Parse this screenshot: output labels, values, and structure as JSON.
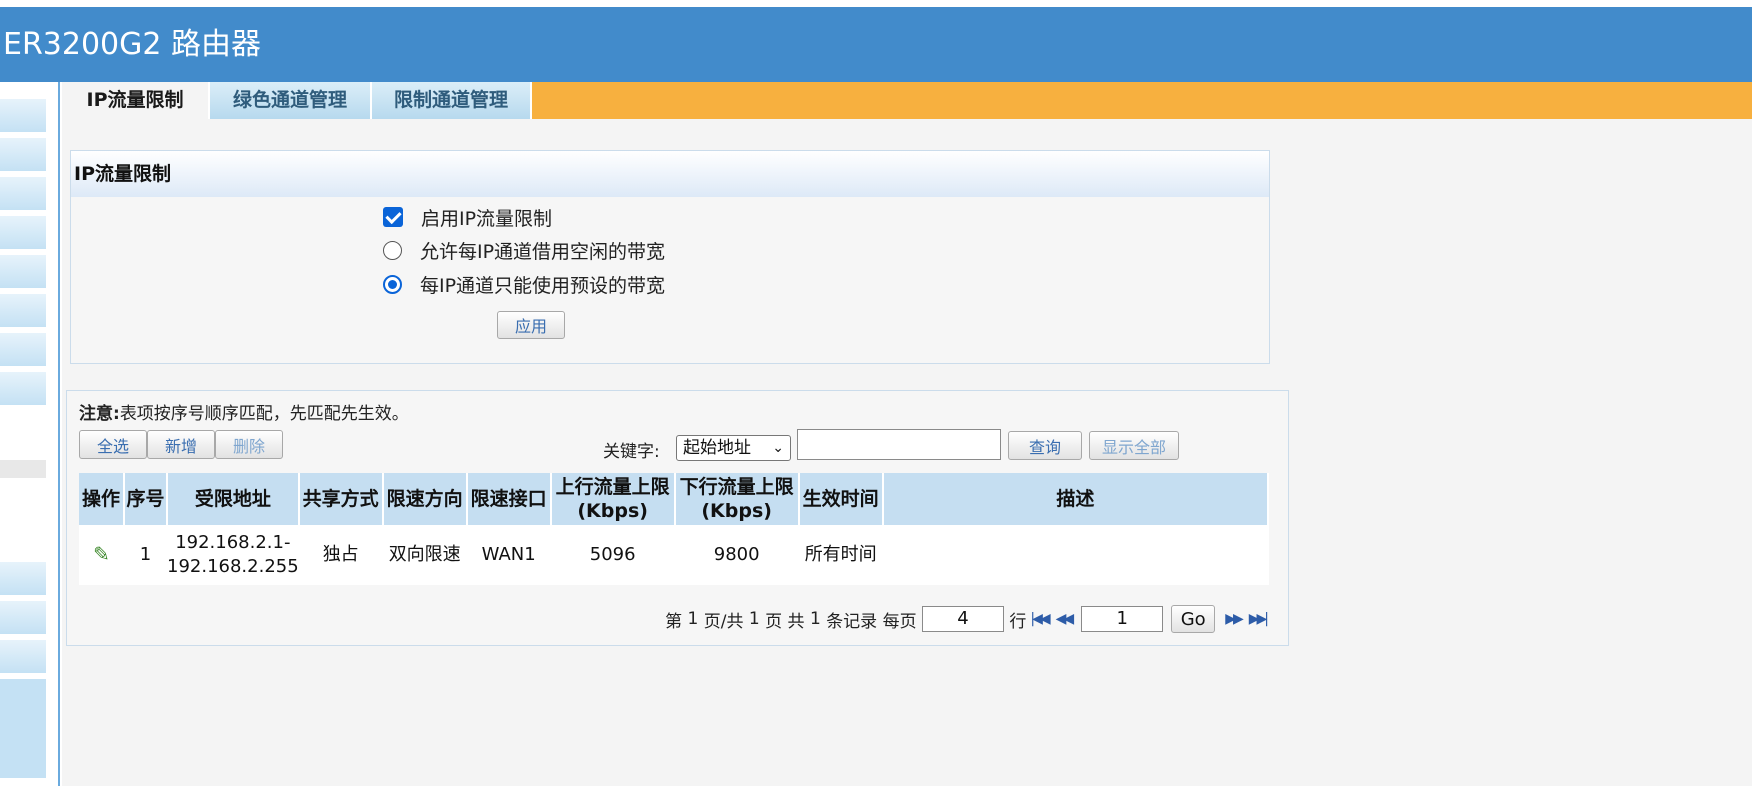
{
  "header": {
    "title": "ER3200G2 路由器"
  },
  "tabs": [
    {
      "label": "IP流量限制",
      "active": true
    },
    {
      "label": "绿色通道管理",
      "active": false
    },
    {
      "label": "限制通道管理",
      "active": false
    }
  ],
  "ip_limit_panel": {
    "title": "IP流量限制",
    "enable_label": "启用IP流量限制",
    "enable_checked": true,
    "mode_options": [
      {
        "label": "允许每IP通道借用空闲的带宽",
        "selected": false
      },
      {
        "label": "每IP通道只能使用预设的带宽",
        "selected": true
      }
    ],
    "apply_label": "应用"
  },
  "rules_panel": {
    "notice_prefix": "注意:",
    "notice_text": "表项按序号顺序匹配，先匹配先生效。",
    "buttons": {
      "select_all": "全选",
      "add": "新增",
      "delete": "删除",
      "search": "查询",
      "show_all": "显示全部"
    },
    "keyword_label": "关键字:",
    "keyword_field": "起始地址",
    "keyword_value": "",
    "columns": [
      "操作",
      "序号",
      "受限地址",
      "共享方式",
      "限速方向",
      "限速接口",
      "上行流量上限\n(Kbps)",
      "下行流量上限\n(Kbps)",
      "生效时间",
      "描述"
    ],
    "rows": [
      {
        "index": "1",
        "address_start": "192.168.2.1-",
        "address_end": "192.168.2.255",
        "share": "独占",
        "direction": "双向限速",
        "iface": "WAN1",
        "up": "5096",
        "down": "9800",
        "time": "所有时间",
        "desc": ""
      }
    ]
  },
  "pager": {
    "page_prefix": "第",
    "current_page": "1",
    "page_mid": "页/共",
    "total_pages": "1",
    "pages_suffix": "页 共",
    "total_records": "1",
    "records_suffix": "条记录 每页",
    "per_page": "4",
    "rows_suffix": "行",
    "goto_page": "1",
    "go_label": "Go"
  },
  "colors": {
    "header": "#428bcb",
    "tabbar": "#f7b03f",
    "table_head": "#c5def1",
    "accent": "#0a64d8"
  }
}
